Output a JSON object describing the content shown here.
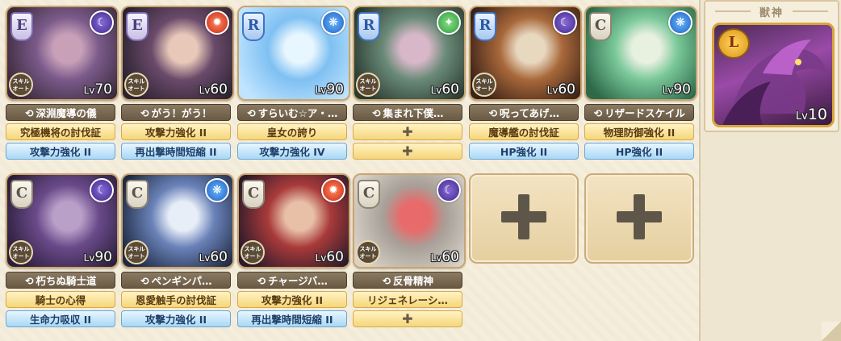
{
  "units": [
    {
      "rank": "E",
      "element": "dark",
      "element_icon": "dark-element-icon",
      "level_prefix": "Lv",
      "level": "70",
      "skill": "深淵魔導の儀",
      "equip1": "究極機将の討伐証",
      "equip2": "攻撃力強化 II",
      "art": [
        "#3a2a3a",
        "#7a5a8a",
        "#c8a0b8"
      ],
      "skill_chip": "スキル\nオート"
    },
    {
      "rank": "E",
      "element": "fire",
      "element_icon": "fire-element-icon",
      "level_prefix": "Lv",
      "level": "60",
      "skill": "がう！がう！",
      "equip1": "攻撃力強化 II",
      "equip2": "再出撃時間短縮 II",
      "art": [
        "#2a2230",
        "#6a4a6a",
        "#e8c8b8"
      ],
      "skill_chip": "スキル\nオート"
    },
    {
      "rank": "R",
      "element": "water",
      "element_icon": "water-element-icon",
      "level_prefix": "Lv",
      "level": "90",
      "skill": "すらいむ☆ア・…",
      "equip1": "皇女の誇り",
      "equip2": "攻撃力強化 IV",
      "art": [
        "#bfe4ff",
        "#7fc0f2",
        "#e8f6ff"
      ],
      "skill_chip": ""
    },
    {
      "rank": "R",
      "element": "wind",
      "element_icon": "wind-element-icon",
      "level_prefix": "Lv",
      "level": "60",
      "skill": "集まれ下僕…",
      "equip1": "",
      "equip2": "",
      "art": [
        "#2a3a30",
        "#6a8a78",
        "#d8b8c8"
      ],
      "skill_chip": "スキル\nオート"
    },
    {
      "rank": "R",
      "element": "dark",
      "element_icon": "dark-element-icon",
      "level_prefix": "Lv",
      "level": "60",
      "skill": "呪ってあげ…",
      "equip1": "魔導艦の討伐証",
      "equip2": "HP強化 II",
      "art": [
        "#3a2218",
        "#a8683a",
        "#e8d8c0"
      ],
      "skill_chip": "スキル\nオート"
    },
    {
      "rank": "C",
      "element": "water",
      "element_icon": "water-element-icon",
      "level_prefix": "Lv",
      "level": "90",
      "skill": "リザードスケイル",
      "equip1": "物理防御強化 II",
      "equip2": "HP強化 II",
      "art": [
        "#2e6a4a",
        "#7ac89a",
        "#e8f0e0"
      ],
      "skill_chip": ""
    },
    {
      "rank": "C",
      "element": "dark",
      "element_icon": "dark-element-icon",
      "level_prefix": "Lv",
      "level": "90",
      "skill": "朽ちぬ騎士道",
      "equip1": "騎士の心得",
      "equip2": "生命力吸収 II",
      "art": [
        "#2a1e3a",
        "#6a4a8a",
        "#b8a0c8"
      ],
      "skill_chip": "スキル\nオート"
    },
    {
      "rank": "C",
      "element": "water",
      "element_icon": "water-element-icon",
      "level_prefix": "Lv",
      "level": "60",
      "skill": "ペンギンパ…",
      "equip1": "恩愛触手の討伐証",
      "equip2": "攻撃力強化 II",
      "art": [
        "#1e2a44",
        "#6a82b8",
        "#e8eef8"
      ],
      "skill_chip": "スキル\nオート"
    },
    {
      "rank": "C",
      "element": "fire",
      "element_icon": "fire-element-icon",
      "level_prefix": "Lv",
      "level": "60",
      "skill": "チャージバ…",
      "equip1": "攻撃力強化 II",
      "equip2": "再出撃時間短縮 II",
      "art": [
        "#2a1a2a",
        "#a83a3a",
        "#e8c0a8"
      ],
      "skill_chip": "スキル\nオート"
    },
    {
      "rank": "C",
      "element": "dark",
      "element_icon": "dark-element-icon",
      "level_prefix": "Lv",
      "level": "60",
      "skill": "反骨精神",
      "equip1": "リジェネレーシ…",
      "equip2": "",
      "art": [
        "#d8d2c8",
        "#a8a098",
        "#e86a6a"
      ],
      "skill_chip": "スキル\nオート"
    }
  ],
  "beast": {
    "title": "獣神",
    "rank": "L",
    "level_prefix": "Lv",
    "level": "10"
  }
}
